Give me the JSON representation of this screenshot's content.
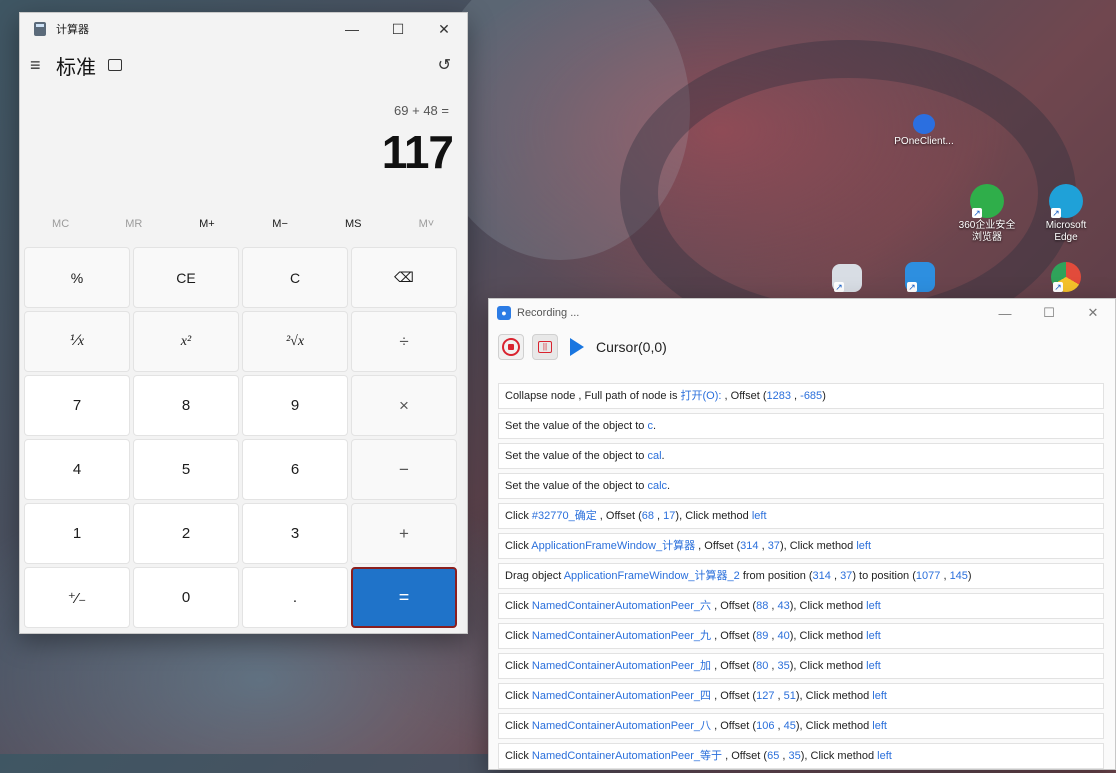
{
  "calculator": {
    "title": "计算器",
    "mode": "标准",
    "keep_on_top_icon": "keep-on-top-icon",
    "history_icon": "history-icon",
    "expression": "69 + 48 =",
    "result": "117",
    "memory": [
      "MC",
      "MR",
      "M+",
      "M−",
      "MS",
      "M˅"
    ],
    "keys": {
      "percent": "%",
      "ce": "CE",
      "c": "C",
      "backspace": "⌫",
      "reciprocal": "⅟x",
      "square": "x²",
      "sqrt": "²√x",
      "divide": "÷",
      "n7": "7",
      "n8": "8",
      "n9": "9",
      "multiply": "×",
      "n4": "4",
      "n5": "5",
      "n6": "6",
      "minus": "−",
      "n1": "1",
      "n2": "2",
      "n3": "3",
      "plus": "+",
      "negate": "⁺⁄₋",
      "n0": "0",
      "dot": ".",
      "equals": "="
    }
  },
  "desktop": {
    "icons": [
      {
        "label": "POneClient...",
        "color": "#2b6fe0"
      },
      {
        "label": "360企业安全\n浏览器",
        "color": "#2fae4a"
      },
      {
        "label": "Microsoft\nEdge",
        "color": "#1fa1d8"
      }
    ]
  },
  "recorder": {
    "title": "Recording ...",
    "cursor": "Cursor(0,0)",
    "logs": [
      {
        "parts": [
          [
            "Collapse node , Full path of node is ",
            0
          ],
          [
            "打开(O):",
            1
          ],
          [
            " , Offset (",
            0
          ],
          [
            "1283",
            1
          ],
          [
            " , ",
            0
          ],
          [
            "-685",
            1
          ],
          [
            ")",
            0
          ]
        ]
      },
      {
        "parts": [
          [
            "Set the value of the object to ",
            0
          ],
          [
            "c",
            1
          ],
          [
            ".",
            0
          ]
        ]
      },
      {
        "parts": [
          [
            "Set the value of the object to ",
            0
          ],
          [
            "cal",
            1
          ],
          [
            ".",
            0
          ]
        ]
      },
      {
        "parts": [
          [
            "Set the value of the object to ",
            0
          ],
          [
            "calc",
            1
          ],
          [
            ".",
            0
          ]
        ]
      },
      {
        "parts": [
          [
            "Click ",
            0
          ],
          [
            "#32770_确定",
            1
          ],
          [
            " , Offset (",
            0
          ],
          [
            "68",
            1
          ],
          [
            " , ",
            0
          ],
          [
            "17",
            1
          ],
          [
            "), Click method ",
            0
          ],
          [
            "left",
            1
          ]
        ]
      },
      {
        "parts": [
          [
            "Click ",
            0
          ],
          [
            "ApplicationFrameWindow_计算器",
            1
          ],
          [
            " , Offset (",
            0
          ],
          [
            "314",
            1
          ],
          [
            " , ",
            0
          ],
          [
            "37",
            1
          ],
          [
            "), Click method ",
            0
          ],
          [
            "left",
            1
          ]
        ]
      },
      {
        "parts": [
          [
            "Drag object ",
            0
          ],
          [
            "ApplicationFrameWindow_计算器_2",
            1
          ],
          [
            " from position (",
            0
          ],
          [
            "314",
            1
          ],
          [
            " , ",
            0
          ],
          [
            "37",
            1
          ],
          [
            ") to position (",
            0
          ],
          [
            "1077",
            1
          ],
          [
            " , ",
            0
          ],
          [
            "145",
            1
          ],
          [
            ")",
            0
          ]
        ]
      },
      {
        "parts": [
          [
            "Click ",
            0
          ],
          [
            "NamedContainerAutomationPeer_六",
            1
          ],
          [
            " , Offset (",
            0
          ],
          [
            "88",
            1
          ],
          [
            " , ",
            0
          ],
          [
            "43",
            1
          ],
          [
            "), Click method ",
            0
          ],
          [
            "left",
            1
          ]
        ]
      },
      {
        "parts": [
          [
            "Click ",
            0
          ],
          [
            "NamedContainerAutomationPeer_九",
            1
          ],
          [
            " , Offset (",
            0
          ],
          [
            "89",
            1
          ],
          [
            " , ",
            0
          ],
          [
            "40",
            1
          ],
          [
            "), Click method ",
            0
          ],
          [
            "left",
            1
          ]
        ]
      },
      {
        "parts": [
          [
            "Click ",
            0
          ],
          [
            "NamedContainerAutomationPeer_加",
            1
          ],
          [
            " , Offset (",
            0
          ],
          [
            "80",
            1
          ],
          [
            " , ",
            0
          ],
          [
            "35",
            1
          ],
          [
            "), Click method ",
            0
          ],
          [
            "left",
            1
          ]
        ]
      },
      {
        "parts": [
          [
            "Click ",
            0
          ],
          [
            "NamedContainerAutomationPeer_四",
            1
          ],
          [
            " , Offset (",
            0
          ],
          [
            "127",
            1
          ],
          [
            " , ",
            0
          ],
          [
            "51",
            1
          ],
          [
            "), Click method ",
            0
          ],
          [
            "left",
            1
          ]
        ]
      },
      {
        "parts": [
          [
            "Click ",
            0
          ],
          [
            "NamedContainerAutomationPeer_八",
            1
          ],
          [
            " , Offset (",
            0
          ],
          [
            "106",
            1
          ],
          [
            " , ",
            0
          ],
          [
            "45",
            1
          ],
          [
            "), Click method ",
            0
          ],
          [
            "left",
            1
          ]
        ]
      },
      {
        "parts": [
          [
            "Click ",
            0
          ],
          [
            "NamedContainerAutomationPeer_等于",
            1
          ],
          [
            " , Offset (",
            0
          ],
          [
            "65",
            1
          ],
          [
            " , ",
            0
          ],
          [
            "35",
            1
          ],
          [
            "), Click method ",
            0
          ],
          [
            "left",
            1
          ]
        ]
      }
    ]
  }
}
